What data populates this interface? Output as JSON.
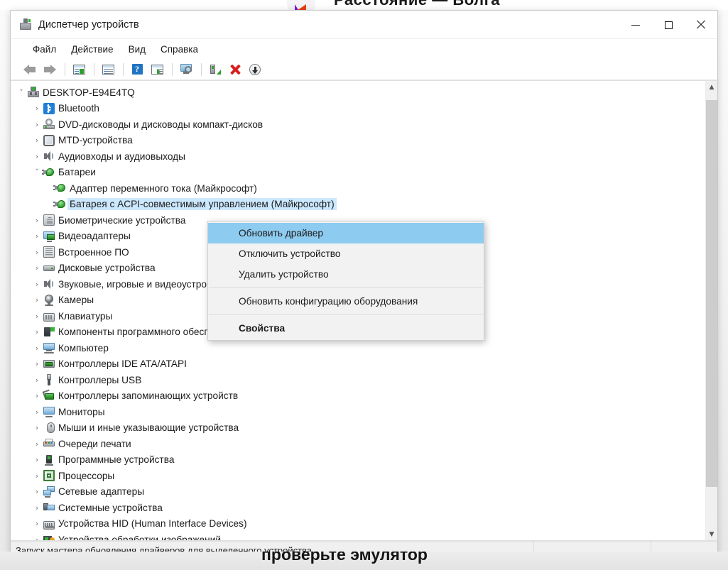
{
  "background": {
    "top_text": "Расстояние — Волга",
    "bottom_text": "проверьте эмулятор",
    "logo_icon": "triangle-logo-icon"
  },
  "window": {
    "title": "Диспетчер устройств",
    "title_icon": "device-manager-icon",
    "controls": {
      "minimize": "minimize-icon",
      "maximize": "maximize-icon",
      "close": "close-icon"
    }
  },
  "menubar": {
    "items": [
      {
        "label": "Файл"
      },
      {
        "label": "Действие"
      },
      {
        "label": "Вид"
      },
      {
        "label": "Справка"
      }
    ]
  },
  "toolbar": {
    "buttons": [
      {
        "name": "back-arrow-icon",
        "type": "arrow-left"
      },
      {
        "name": "forward-arrow-icon",
        "type": "arrow-right"
      },
      {
        "name": "show-hide-console-tree-icon",
        "type": "win-tree"
      },
      {
        "name": "properties-icon",
        "type": "win-props"
      },
      {
        "name": "help-icon",
        "type": "help"
      },
      {
        "name": "show-hide-action-pane-icon",
        "type": "win-play"
      },
      {
        "name": "scan-screen-icon",
        "type": "monitor"
      },
      {
        "name": "update-driver-icon",
        "type": "scan"
      },
      {
        "name": "uninstall-device-icon",
        "type": "delete-x"
      },
      {
        "name": "disable-device-icon",
        "type": "download-circle"
      }
    ]
  },
  "tree": {
    "root": {
      "label": "DESKTOP-E94E4TQ",
      "icon": "computer-root-icon",
      "expander": "expanded"
    },
    "items": [
      {
        "label": "Bluetooth",
        "icon": "bluetooth-icon",
        "expander": "collapsed",
        "indent": 1,
        "selected": false
      },
      {
        "label": "DVD-дисководы и дисководы компакт-дисков",
        "icon": "dvd-drive-icon",
        "expander": "collapsed",
        "indent": 1,
        "selected": false
      },
      {
        "label": "MTD-устройства",
        "icon": "mtd-device-icon",
        "expander": "collapsed",
        "indent": 1,
        "selected": false
      },
      {
        "label": "Аудиовходы и аудиовыходы",
        "icon": "audio-io-icon",
        "expander": "collapsed",
        "indent": 1,
        "selected": false
      },
      {
        "label": "Батареи",
        "icon": "battery-icon",
        "expander": "expanded",
        "indent": 1,
        "selected": false
      },
      {
        "label": "Адаптер переменного тока (Майкрософт)",
        "icon": "battery-icon",
        "expander": "none",
        "indent": 2,
        "selected": false
      },
      {
        "label": "Батарея с ACPI-совместимым управлением (Майкрософт)",
        "icon": "battery-icon",
        "expander": "none",
        "indent": 2,
        "selected": true
      },
      {
        "label": "Биометрические устройства",
        "icon": "biometric-icon",
        "expander": "collapsed",
        "indent": 1,
        "selected": false
      },
      {
        "label": "Видеоадаптеры",
        "icon": "display-adapter-icon",
        "expander": "collapsed",
        "indent": 1,
        "selected": false
      },
      {
        "label": "Встроенное ПО",
        "icon": "firmware-icon",
        "expander": "collapsed",
        "indent": 1,
        "selected": false
      },
      {
        "label": "Дисковые устройства",
        "icon": "disk-drive-icon",
        "expander": "collapsed",
        "indent": 1,
        "selected": false
      },
      {
        "label": "Звуковые, игровые и видеоустройства",
        "icon": "audio-io-icon",
        "expander": "collapsed",
        "indent": 1,
        "selected": false
      },
      {
        "label": "Камеры",
        "icon": "camera-icon",
        "expander": "collapsed",
        "indent": 1,
        "selected": false
      },
      {
        "label": "Клавиатуры",
        "icon": "keyboard-icon",
        "expander": "collapsed",
        "indent": 1,
        "selected": false
      },
      {
        "label": "Компоненты программного обеспечения",
        "icon": "software-component-icon",
        "expander": "collapsed",
        "indent": 1,
        "selected": false
      },
      {
        "label": "Компьютер",
        "icon": "computer-icon",
        "expander": "collapsed",
        "indent": 1,
        "selected": false
      },
      {
        "label": "Контроллеры IDE ATA/ATAPI",
        "icon": "ide-controller-icon",
        "expander": "collapsed",
        "indent": 1,
        "selected": false
      },
      {
        "label": "Контроллеры USB",
        "icon": "usb-controller-icon",
        "expander": "collapsed",
        "indent": 1,
        "selected": false
      },
      {
        "label": "Контроллеры запоминающих устройств",
        "icon": "storage-controller-icon",
        "expander": "collapsed",
        "indent": 1,
        "selected": false
      },
      {
        "label": "Мониторы",
        "icon": "monitor-icon",
        "expander": "collapsed",
        "indent": 1,
        "selected": false
      },
      {
        "label": "Мыши и иные указывающие устройства",
        "icon": "mouse-icon",
        "expander": "collapsed",
        "indent": 1,
        "selected": false
      },
      {
        "label": "Очереди печати",
        "icon": "print-queue-icon",
        "expander": "collapsed",
        "indent": 1,
        "selected": false
      },
      {
        "label": "Программные устройства",
        "icon": "software-device-icon",
        "expander": "collapsed",
        "indent": 1,
        "selected": false
      },
      {
        "label": "Процессоры",
        "icon": "processor-icon",
        "expander": "collapsed",
        "indent": 1,
        "selected": false
      },
      {
        "label": "Сетевые адаптеры",
        "icon": "network-adapter-icon",
        "expander": "collapsed",
        "indent": 1,
        "selected": false
      },
      {
        "label": "Системные устройства",
        "icon": "system-device-icon",
        "expander": "collapsed",
        "indent": 1,
        "selected": false
      },
      {
        "label": "Устройства HID (Human Interface Devices)",
        "icon": "hid-device-icon",
        "expander": "collapsed",
        "indent": 1,
        "selected": false
      },
      {
        "label": "Устройства обработки изображений",
        "icon": "imaging-device-icon",
        "expander": "collapsed",
        "indent": 1,
        "selected": false
      }
    ]
  },
  "context_menu": {
    "items": [
      {
        "label": "Обновить драйвер",
        "highlighted": true,
        "bold": false,
        "separator_after": false
      },
      {
        "label": "Отключить устройство",
        "highlighted": false,
        "bold": false,
        "separator_after": false
      },
      {
        "label": "Удалить устройство",
        "highlighted": false,
        "bold": false,
        "separator_after": true
      },
      {
        "label": "Обновить конфигурацию оборудования",
        "highlighted": false,
        "bold": false,
        "separator_after": true
      },
      {
        "label": "Свойства",
        "highlighted": false,
        "bold": true,
        "separator_after": false
      }
    ]
  },
  "statusbar": {
    "text": "Запуск мастера обновления драйверов для выделенного устройства."
  },
  "colors": {
    "selection_tree": "#cce8ff",
    "menu_highlight": "#8ecbf0",
    "accent_blue": "#1f74c4",
    "delete_red": "#d91e1e",
    "device_green": "#2f9e2f"
  }
}
